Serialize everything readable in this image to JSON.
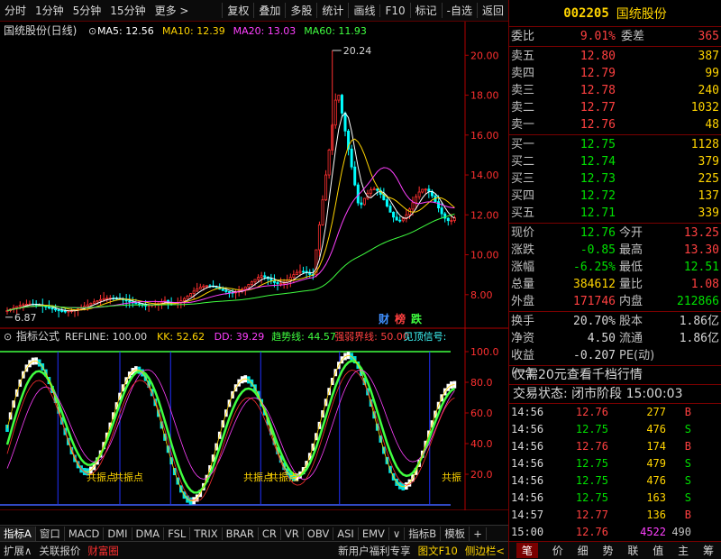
{
  "toolbar": {
    "left": [
      "分时",
      "1分钟",
      "5分钟",
      "15分钟",
      "更多 >"
    ],
    "right": [
      "复权",
      "叠加",
      "多股",
      "统计",
      "画线",
      "F10",
      "标记",
      "-自选",
      "返回"
    ]
  },
  "main_chart": {
    "title": "国统股份(日线)",
    "ma": [
      {
        "label": "MA5: 12.56",
        "color": "#ffffff"
      },
      {
        "label": "MA10: 12.39",
        "color": "#ffd400"
      },
      {
        "label": "MA20: 13.03",
        "color": "#ff40ff"
      },
      {
        "label": "MA60: 11.93",
        "color": "#40ff40"
      }
    ],
    "price_axis": [
      "20.00",
      "18.00",
      "16.00",
      "14.00",
      "12.00",
      "10.00",
      "8.00"
    ],
    "high_label": "20.24",
    "low_label": "6.87",
    "badges": [
      {
        "text": "财",
        "color": "#4090ff"
      },
      {
        "text": "榜",
        "color": "#ff4040"
      },
      {
        "text": "跌",
        "color": "#40ff40"
      }
    ]
  },
  "indicator": {
    "name": "指标公式",
    "params": [
      {
        "label": "REFLINE: 100.00",
        "color": "#d8d8d8"
      },
      {
        "label": "KK: 52.62",
        "color": "#ffd400"
      },
      {
        "label": "DD: 39.29",
        "color": "#ff40ff"
      },
      {
        "label": "趋势线: 44.57",
        "color": "#40ff40"
      },
      {
        "label": "强弱界线: 50.00",
        "color": "#ff4040"
      },
      {
        "label": "见顶信号:",
        "color": "#40ffff"
      }
    ],
    "axis": [
      "100.0",
      "80.0",
      "60.0",
      "40.0",
      "20.0"
    ],
    "signals": [
      "共振点",
      "共振点",
      "共振点",
      "共振点",
      "共振"
    ]
  },
  "date_axis": {
    "labels": [
      "2021年",
      "12",
      "1",
      "2",
      "3",
      "4",
      "5"
    ],
    "period": "日线"
  },
  "tabs": [
    "指标A",
    "窗口",
    "MACD",
    "DMI",
    "DMA",
    "FSL",
    "TRIX",
    "BRAR",
    "CR",
    "VR",
    "OBV",
    "ASI",
    "EMV",
    "∨",
    "指标B",
    "模板",
    "+"
  ],
  "statusbar": {
    "left": [
      "扩展∧",
      "关联报价",
      "财富圈"
    ],
    "right": [
      "新用户福利专享",
      "图文F10",
      "侧边栏<"
    ]
  },
  "stock": {
    "code": "002205",
    "name": "国统股份"
  },
  "order_book": {
    "weibi_label": "委比",
    "weibi": "9.01%",
    "weicha_label": "委差",
    "weicha": "365",
    "sells": [
      {
        "label": "卖五",
        "price": "12.80",
        "vol": "387"
      },
      {
        "label": "卖四",
        "price": "12.79",
        "vol": "99"
      },
      {
        "label": "卖三",
        "price": "12.78",
        "vol": "240"
      },
      {
        "label": "卖二",
        "price": "12.77",
        "vol": "1032"
      },
      {
        "label": "卖一",
        "price": "12.76",
        "vol": "48"
      }
    ],
    "buys": [
      {
        "label": "买一",
        "price": "12.75",
        "vol": "1128"
      },
      {
        "label": "买二",
        "price": "12.74",
        "vol": "379"
      },
      {
        "label": "买三",
        "price": "12.73",
        "vol": "225"
      },
      {
        "label": "买四",
        "price": "12.72",
        "vol": "137"
      },
      {
        "label": "买五",
        "price": "12.71",
        "vol": "339"
      }
    ]
  },
  "quote": {
    "rows1": [
      {
        "l1": "现价",
        "v1": "12.76",
        "c1": "#00e000",
        "l2": "今开",
        "v2": "13.25",
        "c2": "#ff4040"
      },
      {
        "l1": "涨跌",
        "v1": "-0.85",
        "c1": "#00e000",
        "l2": "最高",
        "v2": "13.30",
        "c2": "#ff4040"
      },
      {
        "l1": "涨幅",
        "v1": "-6.25%",
        "c1": "#00e000",
        "l2": "最低",
        "v2": "12.51",
        "c2": "#00e000"
      },
      {
        "l1": "总量",
        "v1": "384612",
        "c1": "#ffd400",
        "l2": "量比",
        "v2": "1.08",
        "c2": "#ff4040"
      },
      {
        "l1": "外盘",
        "v1": "171746",
        "c1": "#ff4040",
        "l2": "内盘",
        "v2": "212866",
        "c2": "#00e000"
      }
    ],
    "rows2": [
      {
        "l1": "换手",
        "v1": "20.70%",
        "c1": "#d8d8d8",
        "l2": "股本",
        "v2": "1.86亿",
        "c2": "#d8d8d8"
      },
      {
        "l1": "净资",
        "v1": "4.50",
        "c1": "#d8d8d8",
        "l2": "流通",
        "v2": "1.86亿",
        "c2": "#d8d8d8"
      },
      {
        "l1": "收益(一)",
        "v1": "-0.207",
        "c1": "#d8d8d8",
        "l2": "PE(动)",
        "v2": "",
        "c2": "#d8d8d8"
      }
    ]
  },
  "promo": "仅需20元查看千档行情",
  "trade_status": "交易状态: 闭市阶段 15:00:03",
  "ticks": [
    {
      "t": "14:56",
      "p": "12.76",
      "v": "277",
      "bs": "B"
    },
    {
      "t": "14:56",
      "p": "12.75",
      "v": "476",
      "bs": "S"
    },
    {
      "t": "14:56",
      "p": "12.76",
      "v": "174",
      "bs": "B"
    },
    {
      "t": "14:56",
      "p": "12.75",
      "v": "479",
      "bs": "S"
    },
    {
      "t": "14:56",
      "p": "12.75",
      "v": "476",
      "bs": "S"
    },
    {
      "t": "14:56",
      "p": "12.75",
      "v": "163",
      "bs": "S"
    },
    {
      "t": "14:57",
      "p": "12.77",
      "v": "136",
      "bs": "B"
    },
    {
      "t": "15:00",
      "p": "12.76",
      "v": "4522",
      "bs": "490"
    }
  ],
  "bottom_tabs": [
    "笔",
    "价",
    "细",
    "势",
    "联",
    "值",
    "主",
    "筹"
  ]
}
